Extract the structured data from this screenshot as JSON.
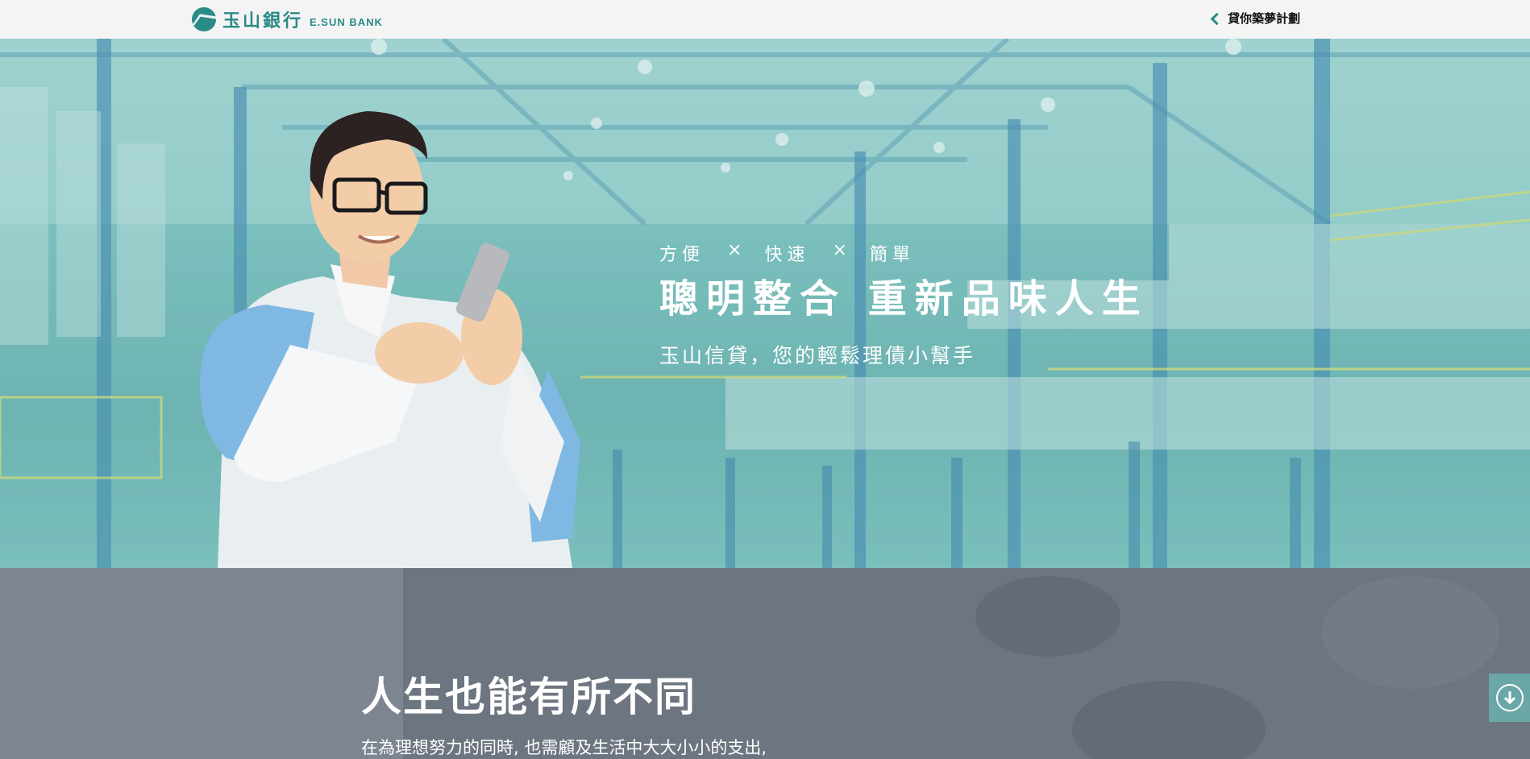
{
  "header": {
    "logo_cn": "玉山銀行",
    "logo_en": "E.SUN BANK",
    "back_link": "貸你築夢計劃"
  },
  "hero": {
    "tags": [
      "方便",
      "快速",
      "簡單"
    ],
    "separator": "×",
    "headline": "聰明整合 重新品味人生",
    "subhead": "玉山信貸，您的輕鬆理債小幫手"
  },
  "section": {
    "title": "人生也能有所不同",
    "description": "在為理想努力的同時,  也需顧及生活中大大小小的支出,"
  },
  "icons": {
    "logo": "esun-logo-icon",
    "back": "chevron-left-icon",
    "scroll": "arrow-down-circle-icon"
  },
  "colors": {
    "brand": "#2a8a86",
    "hero_tint": "#7bbfbd",
    "lower_bg": "#707883",
    "scroll_button": "#6aa7a6"
  }
}
